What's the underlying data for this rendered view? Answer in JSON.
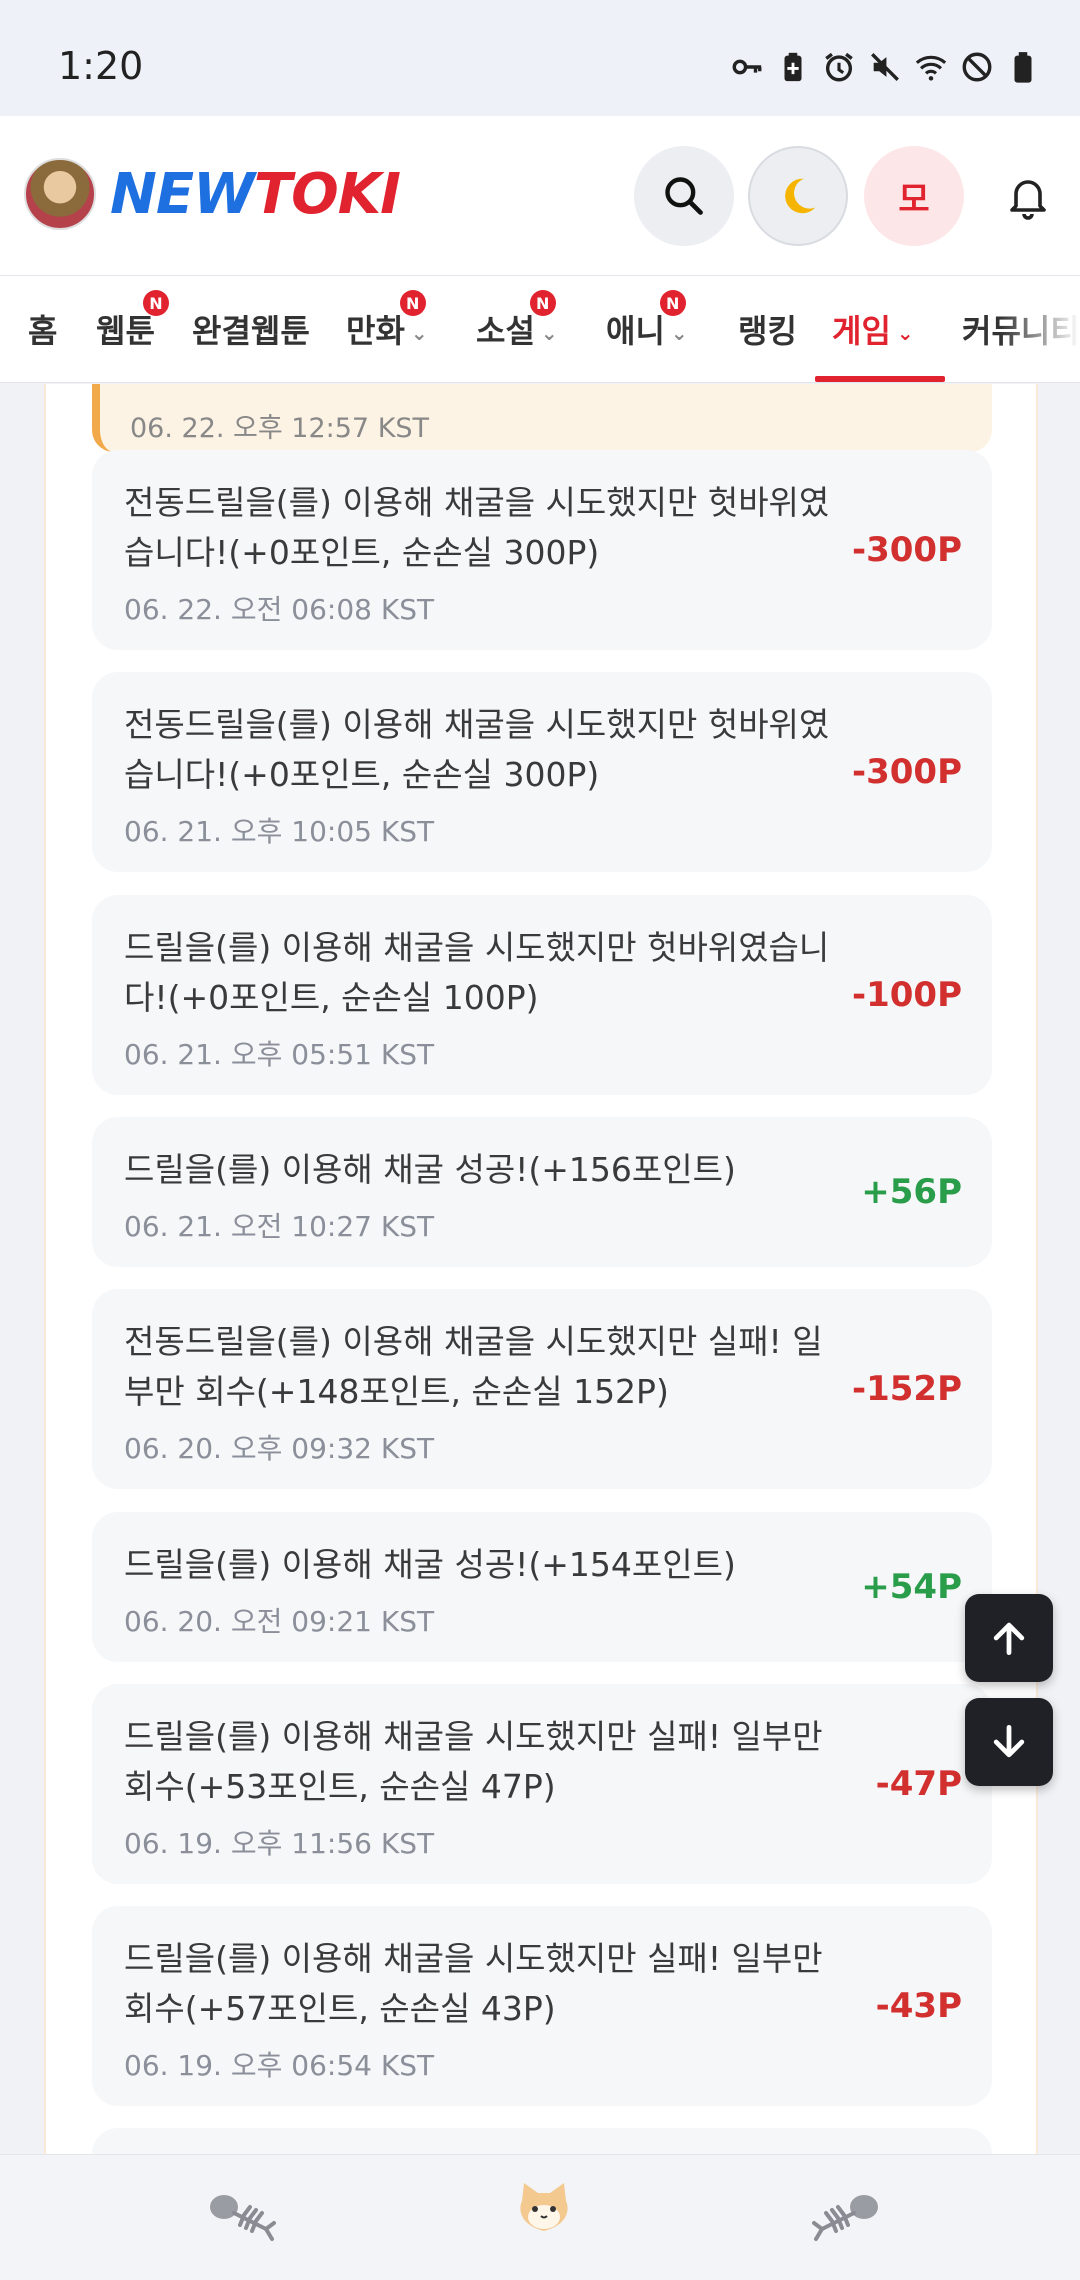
{
  "status_bar": {
    "time": "1:20",
    "icons": [
      "vpn-key-icon",
      "battery-saver-icon",
      "alarm-icon",
      "mute-icon",
      "wifi-icon",
      "do-not-disturb-icon",
      "battery-icon"
    ]
  },
  "header": {
    "logo_new": "NEW",
    "logo_toki": "TOKI",
    "user_initial": "모",
    "icons": [
      "search-icon",
      "moon-icon",
      "bell-icon"
    ]
  },
  "nav": {
    "items": [
      {
        "label": "홈",
        "badge": "",
        "chevron": ""
      },
      {
        "label": "웹툰",
        "badge": "N",
        "chevron": ""
      },
      {
        "label": "완결웹툰",
        "badge": "",
        "chevron": ""
      },
      {
        "label": "만화",
        "badge": "N",
        "chevron": "⌄"
      },
      {
        "label": "소설",
        "badge": "N",
        "chevron": "⌄"
      },
      {
        "label": "애니",
        "badge": "N",
        "chevron": "⌄"
      },
      {
        "label": "랭킹",
        "badge": "",
        "chevron": ""
      },
      {
        "label": "게임",
        "badge": "",
        "chevron": "⌄"
      },
      {
        "label": "커뮤니티",
        "badge": "",
        "chevron": ""
      }
    ],
    "active": "게임"
  },
  "history": {
    "partial_top_date": "06. 22. 오후 12:57 KST",
    "items": [
      {
        "message": "전동드릴을(를) 이용해 채굴을 시도했지만 헛바위였습니다!(+0포인트, 순손실 300P)",
        "date": "06. 22. 오전 06:08 KST",
        "amount": "-300P",
        "type": "neg"
      },
      {
        "message": "전동드릴을(를) 이용해 채굴을 시도했지만 헛바위였습니다!(+0포인트, 순손실 300P)",
        "date": "06. 21. 오후 10:05 KST",
        "amount": "-300P",
        "type": "neg"
      },
      {
        "message": "드릴을(를) 이용해 채굴을 시도했지만 헛바위였습니다!(+0포인트, 순손실 100P)",
        "date": "06. 21. 오후 05:51 KST",
        "amount": "-100P",
        "type": "neg"
      },
      {
        "message": "드릴을(를) 이용해 채굴 성공!(+156포인트)",
        "date": "06. 21. 오전 10:27 KST",
        "amount": "+56P",
        "type": "pos"
      },
      {
        "message": "전동드릴을(를) 이용해 채굴을 시도했지만 실패! 일부만 회수(+148포인트, 순손실 152P)",
        "date": "06. 20. 오후 09:32 KST",
        "amount": "-152P",
        "type": "neg"
      },
      {
        "message": "드릴을(를) 이용해 채굴 성공!(+154포인트)",
        "date": "06. 20. 오전 09:21 KST",
        "amount": "+54P",
        "type": "pos"
      },
      {
        "message": "드릴을(를) 이용해 채굴을 시도했지만 실패! 일부만 회수(+53포인트, 순손실 47P)",
        "date": "06. 19. 오후 11:56 KST",
        "amount": "-47P",
        "type": "neg"
      },
      {
        "message": "드릴을(를) 이용해 채굴을 시도했지만 실패! 일부만 회수(+57포인트, 순손실 43P)",
        "date": "06. 19. 오후 06:54 KST",
        "amount": "-43P",
        "type": "neg"
      }
    ]
  },
  "floating": {
    "icons": [
      "arrow-up-icon",
      "arrow-down-icon"
    ]
  },
  "bottom_bar": {
    "icons": [
      "fish-bone-left-icon",
      "cat-face-icon",
      "fish-bone-right-icon"
    ]
  },
  "colors": {
    "accent": "#e0232e",
    "negative": "#d22f2f",
    "positive": "#2a9d4b",
    "logo_blue": "#1e6fe0"
  }
}
